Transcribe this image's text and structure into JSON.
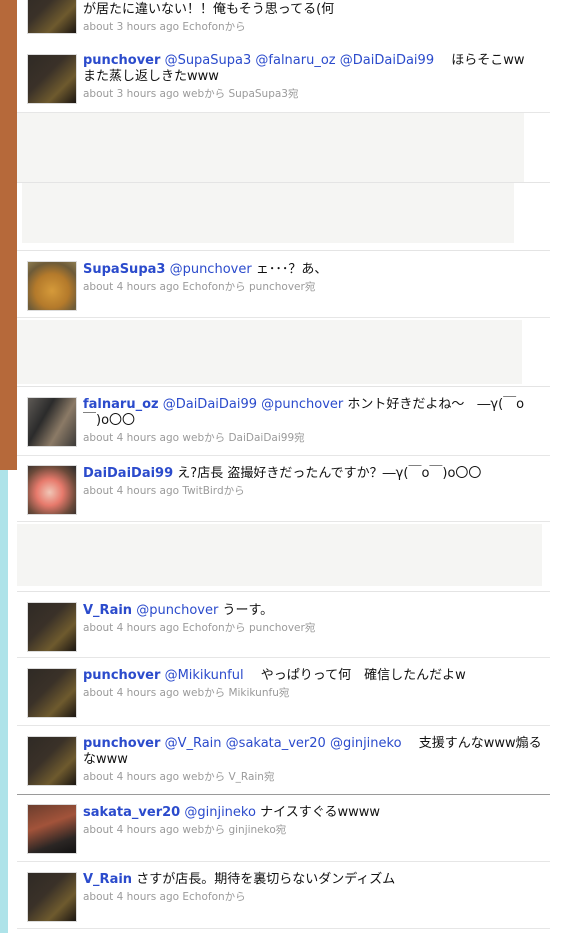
{
  "colors": {
    "username": "#2b4bcc",
    "meta": "#9a9a9a",
    "left_strip_top": "#b6693a",
    "left_strip_bottom": "#aee3e9"
  },
  "tweets": [
    {
      "user": "",
      "text_parts": [
        "が居たに違いない！！俺もそう思ってる(何"
      ],
      "time": "about 3 hours ago",
      "via": "Echofonから",
      "reply": ""
    },
    {
      "user": "punchover",
      "mentions": [
        "@SupaSupa3",
        "@falnaru_oz",
        "@DaiDaiDai99"
      ],
      "text": "　ほらそこww　また蒸し返しきたwww",
      "time": "about 3 hours ago",
      "via": "webから",
      "reply": "SupaSupa3宛"
    },
    {
      "user": "SupaSupa3",
      "mentions": [
        "@punchover"
      ],
      "text": "ェ･･･？あ、",
      "time": "about 4 hours ago",
      "via": "Echofonから",
      "reply": "punchover宛"
    },
    {
      "user": "falnaru_oz",
      "mentions": [
        "@DaiDaiDai99",
        "@punchover"
      ],
      "text": "ホント好きだよね〜　―γ(￣o￣)o〇〇",
      "time": "about 4 hours ago",
      "via": "webから",
      "reply": "DaiDaiDai99宛"
    },
    {
      "user": "DaiDaiDai99",
      "mentions": [],
      "text": "え?店長 盗撮好きだったんですか？―γ(￣o￣)o〇〇",
      "time": "about 4 hours ago",
      "via": "TwitBirdから",
      "reply": ""
    },
    {
      "user": "V_Rain",
      "mentions": [
        "@punchover"
      ],
      "text": "うーす。",
      "time": "about 4 hours ago",
      "via": "Echofonから",
      "reply": "punchover宛"
    },
    {
      "user": "punchover",
      "mentions": [
        "@Mikikunful"
      ],
      "text": "　やっぱりって何　確信したんだよw",
      "time": "about 4 hours ago",
      "via": "webから",
      "reply": "Mikikunfu宛"
    },
    {
      "user": "punchover",
      "mentions": [
        "@V_Rain",
        "@sakata_ver20",
        "@ginjineko"
      ],
      "text": "　支援すんなwww煽るなwww",
      "time": "about 4 hours ago",
      "via": "webから",
      "reply": "V_Rain宛"
    },
    {
      "user": "sakata_ver20",
      "mentions": [
        "@ginjineko"
      ],
      "text": "ナイスすぐるwwww",
      "time": "about 4 hours ago",
      "via": "webから",
      "reply": "ginjineko宛"
    },
    {
      "user": "V_Rain",
      "mentions": [],
      "text": "さすが店長。期待を裏切らないダンディズム",
      "time": "about 4 hours ago",
      "via": "Echofonから",
      "reply": ""
    }
  ]
}
